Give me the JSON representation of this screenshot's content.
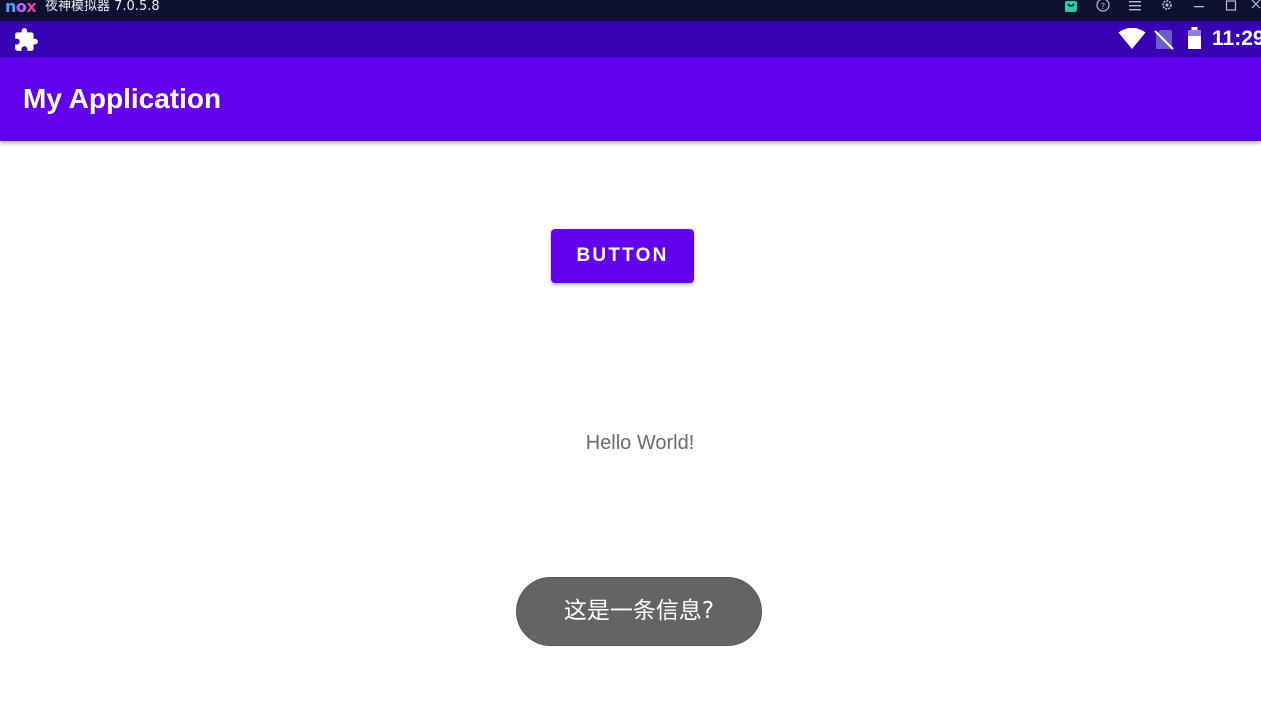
{
  "emulator": {
    "logo": {
      "n": "n",
      "o": "o",
      "x": "x"
    },
    "title": "夜神模拟器 7.0.5.8",
    "icons": [
      "bag-icon",
      "help-icon",
      "menu-icon",
      "gear-icon",
      "minimize-icon",
      "maximize-icon",
      "close-icon"
    ]
  },
  "status_bar": {
    "time": "11:29",
    "icons": [
      "puzzle-icon",
      "wifi-icon",
      "no-sim-icon",
      "battery-icon"
    ]
  },
  "app_bar": {
    "title": "My Application"
  },
  "main": {
    "button_label": "BUTTON",
    "hello_text": "Hello World!"
  },
  "toast": {
    "message": "这是一条信息?"
  },
  "colors": {
    "primary": "#6200ee",
    "primary_dark": "#3700b3",
    "emulator_bar": "#0d1030",
    "toast_bg": "#646464",
    "text_secondary": "#6b6b6b"
  }
}
